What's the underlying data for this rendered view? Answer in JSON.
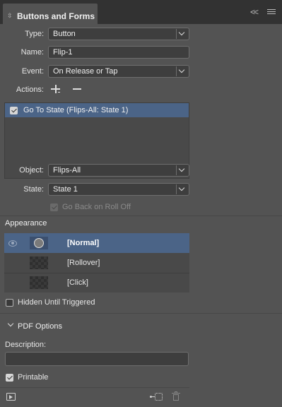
{
  "panel": {
    "title": "Buttons and Forms"
  },
  "form": {
    "type_label": "Type:",
    "type_value": "Button",
    "name_label": "Name:",
    "name_value": "Flip-1",
    "event_label": "Event:",
    "event_value": "On Release or Tap",
    "actions_label": "Actions:",
    "action_items": [
      "Go To State (Flips-All: State 1)"
    ],
    "object_label": "Object:",
    "object_value": "Flips-All",
    "state_label": "State:",
    "state_value": "State 1",
    "go_back_label": "Go Back on Roll Off"
  },
  "appearance": {
    "heading": "Appearance",
    "states": [
      "[Normal]",
      "[Rollover]",
      "[Click]"
    ]
  },
  "hidden_label": "Hidden Until Triggered",
  "pdf": {
    "heading": "PDF Options",
    "description_label": "Description:",
    "description_value": "",
    "printable_label": "Printable"
  },
  "colors": {
    "panel_bg": "#535353",
    "selection": "#4b6487",
    "field_bg": "#3e3e3e"
  },
  "icons": {
    "tab_collapse": "collapse-icon",
    "panel_collapse": "double-chevron-left-icon",
    "panel_menu": "hamburger-menu-icon",
    "add_action": "plus-icon",
    "remove_action": "minus-icon",
    "visibility": "eye-icon",
    "preview": "preview-icon",
    "convert": "convert-to-button-icon",
    "delete": "trash-icon"
  }
}
